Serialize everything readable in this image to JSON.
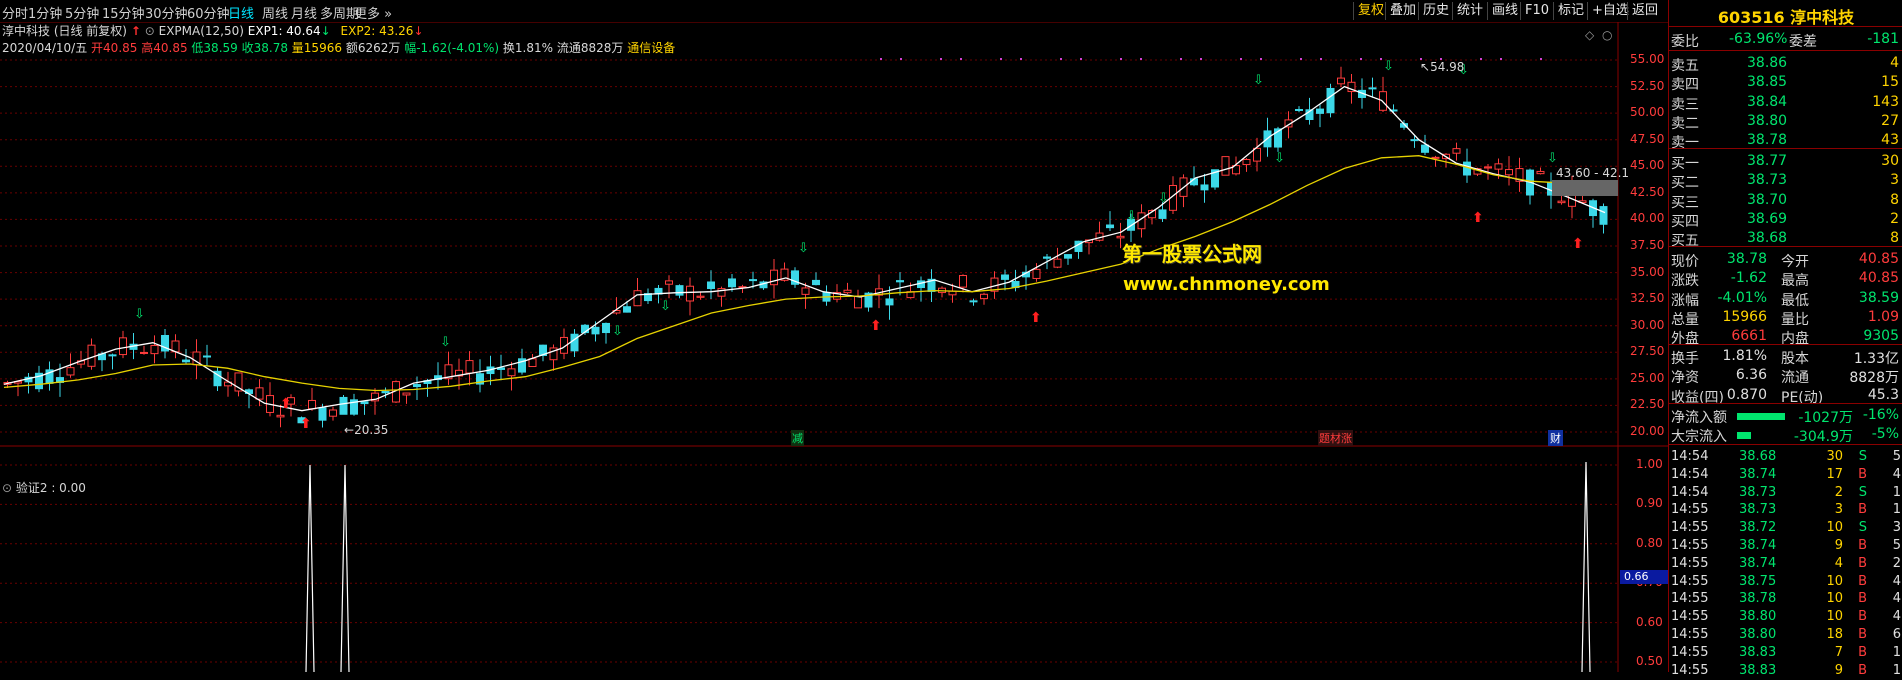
{
  "toolbar": {
    "periods": [
      "分时",
      "1分钟",
      "5分钟",
      "15分钟",
      "30分钟",
      "60分钟",
      "日线",
      "周线",
      "月线",
      "多周期",
      "更多"
    ],
    "active_period": "日线",
    "right_buttons": [
      "复权",
      "叠加",
      "历史",
      "统计",
      "画线",
      "F10",
      "标记",
      "+自选",
      "返回"
    ]
  },
  "info": {
    "title": "淳中科技 (日线 前复权)",
    "indicator": "EXPMA(12,50)",
    "exp1": "EXP1: 40.64",
    "exp2": "EXP2: 43.26",
    "date": "2020/04/10/五",
    "open": "开40.85",
    "high": "高40.85",
    "low": "低38.59",
    "close": "收38.78",
    "volume": "量15966",
    "amount": "额6262万",
    "change": "幅-1.62(-4.01%)",
    "turnover": "换1.81%",
    "float": "流通8828万",
    "sector": "通信设备"
  },
  "chart_annotations": {
    "high_label": "54.98",
    "low_label": "20.35",
    "range_label": "43.60 - 42.1",
    "bottom_tags": [
      "减",
      "题材涨",
      "财"
    ],
    "sub_indicator": "验证2 : 0.00",
    "sub_cursor_value": "0.66"
  },
  "watermark": {
    "line1": "第一股票公式网",
    "line2": "www.chnmoney.com"
  },
  "price_axis": [
    "55.00",
    "52.50",
    "50.00",
    "47.50",
    "45.00",
    "42.50",
    "40.00",
    "37.50",
    "35.00",
    "32.50",
    "30.00",
    "27.50",
    "25.00",
    "22.50",
    "20.00"
  ],
  "sub_axis": [
    "1.00",
    "0.90",
    "0.80",
    "0.70",
    "0.60",
    "0.50"
  ],
  "chart_data": {
    "type": "line",
    "title": "淳中科技 日线",
    "series": [
      {
        "name": "EXP1",
        "values": [
          24.5,
          25.3,
          26.6,
          27.8,
          28.4,
          27.0,
          24.8,
          22.7,
          22.0,
          22.6,
          23.1,
          24.6,
          25.2,
          25.8,
          26.7,
          27.9,
          30.4,
          32.9,
          33.1,
          33.2,
          33.6,
          34.5,
          33.2,
          32.7,
          33.5,
          34.3,
          33.2,
          34.1,
          36.0,
          37.9,
          38.8,
          41.1,
          43.9,
          44.9,
          47.8,
          50.0,
          52.5,
          51.2,
          47.5,
          45.3,
          44.3,
          43.5,
          42.1,
          40.64
        ]
      },
      {
        "name": "EXP2",
        "values": [
          24.2,
          24.5,
          24.9,
          25.5,
          26.3,
          26.4,
          26.0,
          25.2,
          24.6,
          24.1,
          23.9,
          24.0,
          24.3,
          24.8,
          25.2,
          26.1,
          27.1,
          28.8,
          30.0,
          31.2,
          31.9,
          32.5,
          32.7,
          32.8,
          33.1,
          33.3,
          33.2,
          33.5,
          34.2,
          35.0,
          35.8,
          37.2,
          38.4,
          39.8,
          41.4,
          43.2,
          44.8,
          45.8,
          46.0,
          45.2,
          44.2,
          43.6,
          43.4,
          43.26
        ]
      }
    ],
    "ylim": [
      20,
      55
    ]
  },
  "panel": {
    "title": "603516 淳中科技",
    "weibi_label": "委比",
    "weibi": "-63.96%",
    "weicha_label": "委差",
    "weicha": "-181",
    "asks": [
      {
        "label": "卖五",
        "price": "38.86",
        "vol": "4"
      },
      {
        "label": "卖四",
        "price": "38.85",
        "vol": "15"
      },
      {
        "label": "卖三",
        "price": "38.84",
        "vol": "143"
      },
      {
        "label": "卖二",
        "price": "38.80",
        "vol": "27"
      },
      {
        "label": "卖一",
        "price": "38.78",
        "vol": "43"
      }
    ],
    "bids": [
      {
        "label": "买一",
        "price": "38.77",
        "vol": "30"
      },
      {
        "label": "买二",
        "price": "38.73",
        "vol": "3"
      },
      {
        "label": "买三",
        "price": "38.70",
        "vol": "8"
      },
      {
        "label": "买四",
        "price": "38.69",
        "vol": "2"
      },
      {
        "label": "买五",
        "price": "38.68",
        "vol": "8"
      }
    ],
    "stats": [
      {
        "l1": "现价",
        "v1": "38.78",
        "l2": "今开",
        "v2": "40.85",
        "c1": "green",
        "c2": "red"
      },
      {
        "l1": "涨跌",
        "v1": "-1.62",
        "l2": "最高",
        "v2": "40.85",
        "c1": "green",
        "c2": "red"
      },
      {
        "l1": "涨幅",
        "v1": "-4.01%",
        "l2": "最低",
        "v2": "38.59",
        "c1": "green",
        "c2": "green"
      },
      {
        "l1": "总量",
        "v1": "15966",
        "l2": "量比",
        "v2": "1.09",
        "c1": "yel",
        "c2": "red"
      },
      {
        "l1": "外盘",
        "v1": "6661",
        "l2": "内盘",
        "v2": "9305",
        "c1": "red",
        "c2": "green"
      }
    ],
    "stats2": [
      {
        "l1": "换手",
        "v1": "1.81%",
        "l2": "股本",
        "v2": "1.33亿"
      },
      {
        "l1": "净资",
        "v1": "6.36",
        "l2": "流通",
        "v2": "8828万"
      },
      {
        "l1": "收益(四)",
        "v1": "0.870",
        "l2": "PE(动)",
        "v2": "45.3"
      }
    ],
    "flow": [
      {
        "label": "净流入额",
        "val": "-1027万",
        "pct": "-16%"
      },
      {
        "label": "大宗流入",
        "val": "-304.9万",
        "pct": "-5%"
      }
    ],
    "ticks": [
      {
        "t": "14:54",
        "p": "38.68",
        "v": "30",
        "s": "S",
        "n": "5"
      },
      {
        "t": "14:54",
        "p": "38.74",
        "v": "17",
        "s": "B",
        "n": "4"
      },
      {
        "t": "14:54",
        "p": "38.73",
        "v": "2",
        "s": "S",
        "n": "1"
      },
      {
        "t": "14:55",
        "p": "38.73",
        "v": "3",
        "s": "B",
        "n": "1"
      },
      {
        "t": "14:55",
        "p": "38.72",
        "v": "10",
        "s": "S",
        "n": "3"
      },
      {
        "t": "14:55",
        "p": "38.74",
        "v": "9",
        "s": "B",
        "n": "5"
      },
      {
        "t": "14:55",
        "p": "38.74",
        "v": "4",
        "s": "B",
        "n": "2"
      },
      {
        "t": "14:55",
        "p": "38.75",
        "v": "10",
        "s": "B",
        "n": "4"
      },
      {
        "t": "14:55",
        "p": "38.78",
        "v": "10",
        "s": "B",
        "n": "4"
      },
      {
        "t": "14:55",
        "p": "38.80",
        "v": "10",
        "s": "B",
        "n": "4"
      },
      {
        "t": "14:55",
        "p": "38.80",
        "v": "18",
        "s": "B",
        "n": "6"
      },
      {
        "t": "14:55",
        "p": "38.83",
        "v": "7",
        "s": "B",
        "n": "1"
      },
      {
        "t": "14:55",
        "p": "38.83",
        "v": "9",
        "s": "B",
        "n": "1"
      }
    ]
  }
}
